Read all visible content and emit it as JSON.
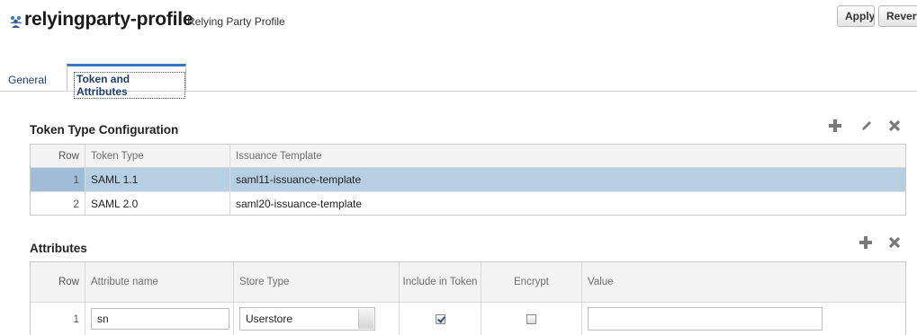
{
  "header": {
    "title": "relyingparty-profile",
    "subtitle": "Relying Party Profile",
    "apply_label": "Apply",
    "revert_label": "Revert"
  },
  "tabs": [
    {
      "label": "General",
      "active": false
    },
    {
      "label": "Token and Attributes",
      "active": true
    }
  ],
  "token_config": {
    "title": "Token Type Configuration",
    "columns": [
      "Row",
      "Token Type",
      "Issuance Template"
    ],
    "rows": [
      {
        "row": "1",
        "token_type": "SAML 1.1",
        "template": "saml11-issuance-template",
        "selected": true
      },
      {
        "row": "2",
        "token_type": "SAML 2.0",
        "template": "saml20-issuance-template",
        "selected": false
      }
    ]
  },
  "attributes": {
    "title": "Attributes",
    "columns": [
      "Row",
      "Attribute name",
      "Store Type",
      "Include in Token",
      "Encrypt",
      "Value"
    ],
    "rows": [
      {
        "row": "1",
        "name": "sn",
        "store_type": "Userstore",
        "include_in_token": true,
        "encrypt": false,
        "value": ""
      }
    ]
  },
  "icons": {
    "header": "users-icon",
    "add": "add-icon",
    "edit": "edit-icon",
    "delete": "delete-icon"
  },
  "colors": {
    "selected_row": "#b7cfe3",
    "active_tab_border": "#3c76c2",
    "toolbar_icon": "#7a7a7a"
  }
}
